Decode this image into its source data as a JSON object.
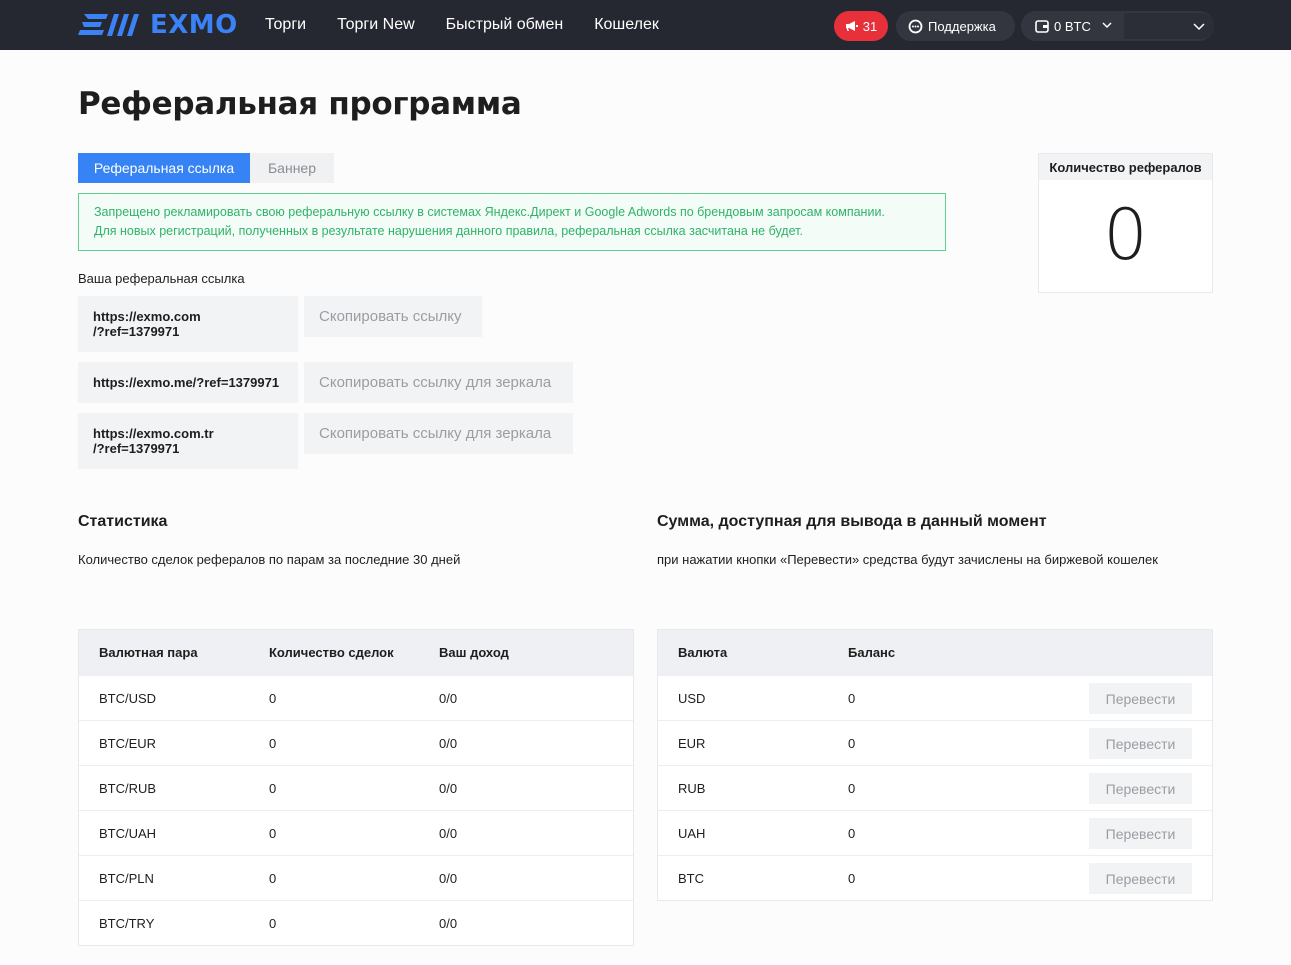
{
  "header": {
    "logo_text": "EXMO",
    "nav": [
      "Торги",
      "Торги New",
      "Быстрый обмен",
      "Кошелек"
    ],
    "notifications_count": "31",
    "support_label": "Поддержка",
    "wallet_label": "0 BTC",
    "accent_color": "#3b82f6",
    "alert_color": "#e8303b"
  },
  "page": {
    "title": "Реферальная программа"
  },
  "tabs": {
    "referral_link": "Реферальная ссылка",
    "banner": "Баннер"
  },
  "notice": {
    "line1": "Запрещено рекламировать свою реферальную ссылку в системах Яндекс.Директ и Google Adwords по брендовым запросам компании.",
    "line2": "Для новых регистраций, полученных в результате нарушения данного правила, реферальная ссылка засчитана не будет."
  },
  "referral": {
    "label": "Ваша реферальная ссылка",
    "links": [
      {
        "line1": "https://exmo.com",
        "line2": "/?ref=1379971",
        "button": "Скопировать ссылку"
      },
      {
        "line1": "https://exmo.me/?ref=1379971",
        "line2": "",
        "button": "Скопировать ссылку для зеркала"
      },
      {
        "line1": "https://exmo.com.tr",
        "line2": "/?ref=1379971",
        "button": "Скопировать ссылку для зеркала"
      }
    ]
  },
  "referral_count": {
    "label": "Количество рефералов",
    "value": "0"
  },
  "statistics": {
    "title": "Статистика",
    "subtitle": "Количество сделок рефералов по парам за последние 30 дней",
    "columns": [
      "Валютная пара",
      "Количество сделок",
      "Ваш доход"
    ],
    "rows": [
      [
        "BTC/USD",
        "0",
        "0/0"
      ],
      [
        "BTC/EUR",
        "0",
        "0/0"
      ],
      [
        "BTC/RUB",
        "0",
        "0/0"
      ],
      [
        "BTC/UAH",
        "0",
        "0/0"
      ],
      [
        "BTC/PLN",
        "0",
        "0/0"
      ],
      [
        "BTC/TRY",
        "0",
        "0/0"
      ]
    ]
  },
  "withdrawal": {
    "title": "Сумма, доступная для вывода в данный момент",
    "subtitle": "при нажатии кнопки «Перевести» средства будут зачислены на биржевой кошелек",
    "columns": [
      "Валюта",
      "Баланс"
    ],
    "transfer_label": "Перевести",
    "rows": [
      [
        "USD",
        "0"
      ],
      [
        "EUR",
        "0"
      ],
      [
        "RUB",
        "0"
      ],
      [
        "UAH",
        "0"
      ],
      [
        "BTC",
        "0"
      ]
    ]
  }
}
